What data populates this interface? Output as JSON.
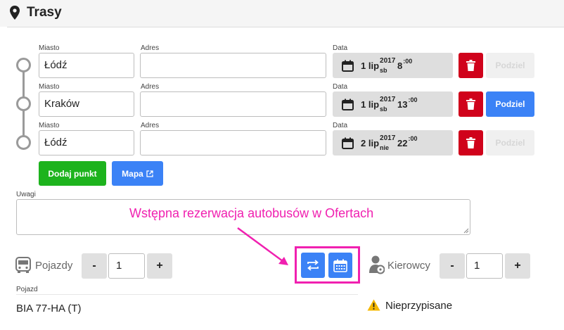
{
  "header": {
    "title": "Trasy"
  },
  "route": {
    "labels": {
      "city": "Miasto",
      "address": "Adres",
      "date": "Data"
    },
    "stops": [
      {
        "city": "Łódź",
        "address": "",
        "day": "1 lip",
        "year": "2017",
        "weekday": "sb",
        "hour": "8",
        "minute": ":00",
        "split_label": "Podziel",
        "split_enabled": false
      },
      {
        "city": "Kraków",
        "address": "",
        "day": "1 lip",
        "year": "2017",
        "weekday": "sb",
        "hour": "13",
        "minute": ":00",
        "split_label": "Podziel",
        "split_enabled": true
      },
      {
        "city": "Łódź",
        "address": "",
        "day": "2 lip",
        "year": "2017",
        "weekday": "nie",
        "hour": "22",
        "minute": ":00",
        "split_label": "Podziel",
        "split_enabled": false
      }
    ],
    "add_point_label": "Dodaj punkt",
    "map_label": "Mapa"
  },
  "notes": {
    "label": "Uwagi",
    "value": ""
  },
  "annotation": {
    "text": "Wstępna rezerwacja autobusów w Ofertach"
  },
  "vehicles": {
    "label": "Pojazdy",
    "minus": "-",
    "plus": "+",
    "count": "1"
  },
  "drivers": {
    "label": "Kierowcy",
    "minus": "-",
    "plus": "+",
    "count": "1"
  },
  "vehicle_table": {
    "column": "Pojazd",
    "value": "BIA 77-HA (T)"
  },
  "status": {
    "unassigned": "Nieprzypisane"
  },
  "colors": {
    "primary": "#3b82f6",
    "danger": "#d0021b",
    "success": "#1db31d",
    "highlight": "#f020b0",
    "warning": "#f5b800"
  }
}
